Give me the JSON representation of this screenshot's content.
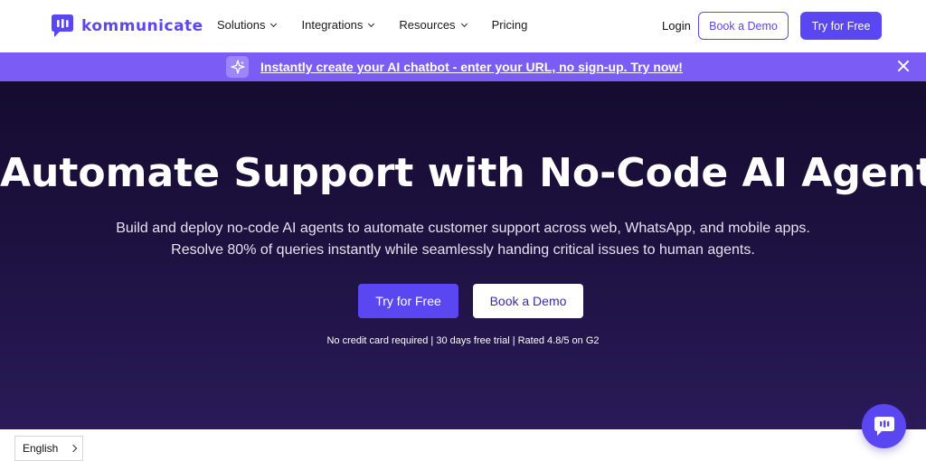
{
  "brand": {
    "name": "kommunicate",
    "color": "#5b47f2"
  },
  "nav": {
    "items": [
      {
        "label": "Solutions",
        "has_dropdown": true
      },
      {
        "label": "Integrations",
        "has_dropdown": true
      },
      {
        "label": "Resources",
        "has_dropdown": true
      },
      {
        "label": "Pricing",
        "has_dropdown": false
      }
    ],
    "login": "Login",
    "book_demo": "Book a Demo",
    "try_free": "Try for Free"
  },
  "banner": {
    "icon": "sparkle-icon",
    "link_text": "Instantly create your AI chatbot - enter your URL, no sign-up. Try now!",
    "close_icon": "close-icon",
    "color": "#7b5cf5"
  },
  "hero": {
    "title": "Automate Support with No-Code AI Agents",
    "subtitle_line1": "Build and deploy no-code AI agents to automate customer support across web, WhatsApp, and mobile apps.",
    "subtitle_line2": "Resolve 80% of queries instantly while seamlessly handing critical issues to human agents.",
    "try_free": "Try for Free",
    "book_demo": "Book a Demo",
    "note": "No credit card required | 30 days free trial | Rated 4.8/5 on G2"
  },
  "language_selector": {
    "label": "English"
  },
  "chat_widget": {
    "icon": "chat-bubble-icon"
  }
}
